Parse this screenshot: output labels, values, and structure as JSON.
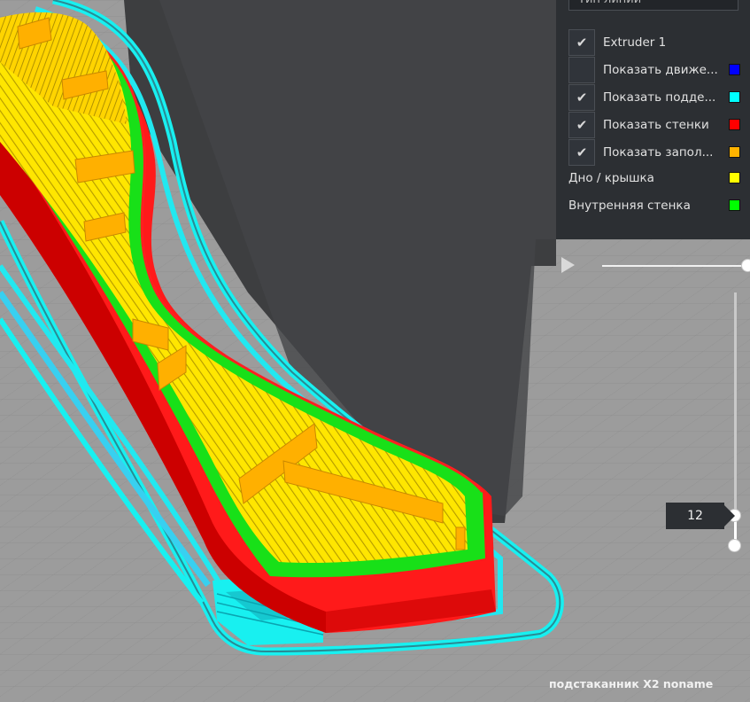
{
  "legend": {
    "dropdown_label": "Тип линии",
    "items": [
      {
        "label": "Extruder 1",
        "checked": true,
        "has_checkbox": true,
        "color": null
      },
      {
        "label": "Показать движе...",
        "checked": false,
        "has_checkbox": true,
        "color": "#0000ff"
      },
      {
        "label": "Показать подде...",
        "checked": true,
        "has_checkbox": true,
        "color": "#00ffff"
      },
      {
        "label": "Показать стенки",
        "checked": true,
        "has_checkbox": true,
        "color": "#ff0000"
      },
      {
        "label": "Показать запол...",
        "checked": true,
        "has_checkbox": true,
        "color": "#ffb300"
      },
      {
        "label": "Дно / крышка",
        "has_checkbox": false,
        "color": "#ffff00"
      },
      {
        "label": "Внутренняя стенка",
        "has_checkbox": false,
        "color": "#00ff00"
      }
    ],
    "check_glyph": "✔"
  },
  "layer_slider": {
    "current_layer": "12"
  },
  "job_name": "подстаканник X2 noname",
  "colors": {
    "wall_outer": "#ff1a1a",
    "wall_inner": "#20e020",
    "infill": "#ffd800",
    "support": "#16f0f0",
    "build_plate": "#9b9b9b",
    "build_volume_shadow": "#3a3b3d"
  }
}
